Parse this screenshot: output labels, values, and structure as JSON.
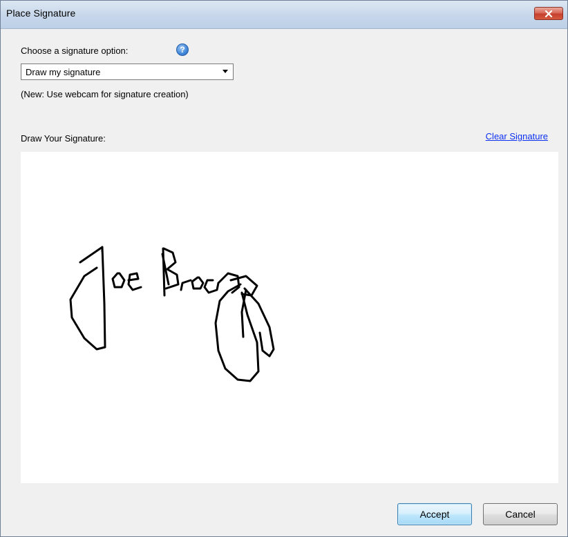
{
  "window": {
    "title": "Place Signature"
  },
  "option": {
    "label": "Choose a signature option:",
    "selected": "Draw my signature",
    "note": "(New: Use webcam for signature creation)"
  },
  "signature": {
    "label": "Draw Your Signature:",
    "clear_label": "Clear Signature",
    "handwritten_text": "Joe Bloggs"
  },
  "buttons": {
    "accept": "Accept",
    "cancel": "Cancel"
  },
  "colors": {
    "link": "#0b2ff1",
    "ink": "#000000",
    "close": "#c6402e"
  },
  "icons": {
    "help": "help-icon",
    "close": "close-icon",
    "dropdown": "chevron-down-icon"
  }
}
